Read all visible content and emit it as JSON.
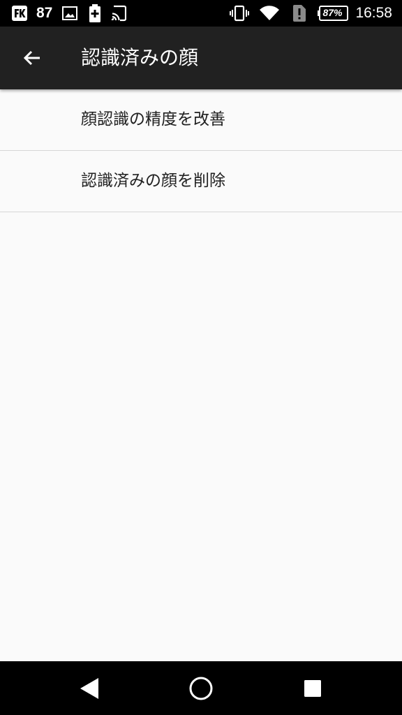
{
  "status_bar": {
    "notification_count": "87",
    "battery_percent": "87%",
    "time": "16:58",
    "icons": [
      "fk-app-icon",
      "image-icon",
      "battery-saver-icon",
      "cast-icon",
      "vibrate-icon",
      "wifi-icon",
      "sim-alert-icon",
      "battery-icon"
    ]
  },
  "app_bar": {
    "title": "認識済みの顔",
    "back_icon": "arrow-back-icon"
  },
  "settings": {
    "items": [
      {
        "label": "顔認識の精度を改善"
      },
      {
        "label": "認識済みの顔を削除"
      }
    ]
  },
  "nav_bar": {
    "icons": [
      "nav-back-icon",
      "nav-home-icon",
      "nav-recents-icon"
    ]
  },
  "colors": {
    "status_bar_bg": "#000000",
    "app_bar_bg": "#212121",
    "page_bg": "#fafafa",
    "divider": "#d6d6d6",
    "text_primary": "#212121"
  }
}
